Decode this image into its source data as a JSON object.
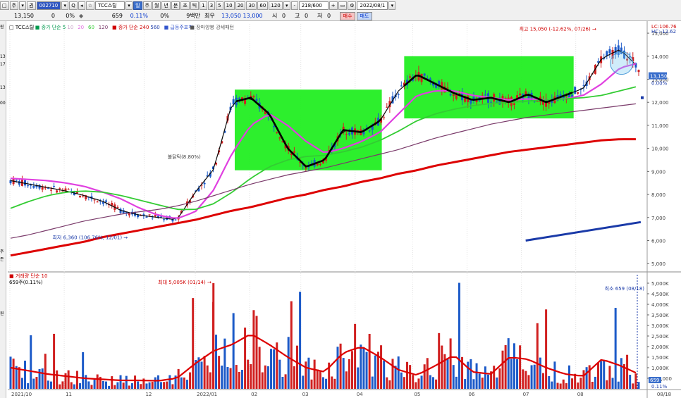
{
  "toolbar": {
    "row1": [
      {
        "name": "layout-icon",
        "label": "□",
        "kind": "btn"
      },
      {
        "name": "menu-main-button",
        "label": "주",
        "kind": "btn"
      },
      {
        "name": "dropdown-icon",
        "label": "▾",
        "kind": "btn"
      },
      {
        "name": "market-select",
        "label": "권",
        "kind": "btn"
      },
      {
        "name": "stock-code-field",
        "label": "002710",
        "kind": "code"
      },
      {
        "name": "code-dropdown-icon",
        "label": "▾",
        "kind": "btn"
      },
      {
        "name": "search-icon",
        "label": "Q",
        "kind": "btn"
      },
      {
        "name": "prev-icon",
        "label": "◂",
        "kind": "btn"
      },
      {
        "name": "favorite-icon",
        "label": "☆",
        "kind": "btn"
      },
      {
        "name": "stock-name-field",
        "label": "TCC스틸",
        "kind": "name"
      },
      {
        "name": "name-dropdown-icon",
        "label": "▾",
        "kind": "btn"
      },
      {
        "name": "period-day-button",
        "label": "일",
        "kind": "sel"
      },
      {
        "name": "period-week-button",
        "label": "주",
        "kind": "btn"
      },
      {
        "name": "period-month-button",
        "label": "월",
        "kind": "btn"
      },
      {
        "name": "period-year-button",
        "label": "년",
        "kind": "btn"
      },
      {
        "name": "period-minute-button",
        "label": "분",
        "kind": "btn"
      },
      {
        "name": "period-second-button",
        "label": "초",
        "kind": "btn"
      },
      {
        "name": "period-tick-button",
        "label": "틱",
        "kind": "btn"
      },
      {
        "name": "interval-1-button",
        "label": "1",
        "kind": "btn"
      },
      {
        "name": "interval-3-button",
        "label": "3",
        "kind": "btn"
      },
      {
        "name": "interval-5-button",
        "label": "5",
        "kind": "btn"
      },
      {
        "name": "interval-10-button",
        "label": "10",
        "kind": "btn"
      },
      {
        "name": "interval-20-button",
        "label": "20",
        "kind": "btn"
      },
      {
        "name": "interval-30-button",
        "label": "30",
        "kind": "btn"
      },
      {
        "name": "interval-60-button",
        "label": "60",
        "kind": "btn"
      },
      {
        "name": "interval-120-button",
        "label": "120",
        "kind": "btn"
      },
      {
        "name": "interval-dropdown-icon",
        "label": "▾",
        "kind": "btn"
      },
      {
        "name": "minus-button",
        "label": "-",
        "kind": "btn"
      },
      {
        "name": "count-field",
        "label": "218/600",
        "kind": "name"
      },
      {
        "name": "plus-button",
        "label": "+",
        "kind": "btn"
      },
      {
        "name": "range-button",
        "label": "▭",
        "kind": "btn"
      },
      {
        "name": "settings-icon",
        "label": "⚙",
        "kind": "btn"
      },
      {
        "name": "date-field",
        "label": "2022/08/1",
        "kind": "name"
      },
      {
        "name": "calendar-icon",
        "label": "▾",
        "kind": "btn"
      }
    ],
    "quote": {
      "price": "13,150",
      "change": "0",
      "change_pct": "0%",
      "dot_icon": "◆",
      "volume": "659",
      "volume_pct": "0.11%",
      "zero_pct": "0%",
      "turnover": "9백만",
      "tag_recent": "최우",
      "hi_lo": "13,050 13,000",
      "open_label": "시",
      "open": "0",
      "high_label": "고",
      "high": "0",
      "low_label": "저",
      "low": "0",
      "buy_label": "매수",
      "sell_label": "매도"
    }
  },
  "left_tags": [
    "원",
    "",
    "",
    "",
    "13",
    "17",
    "",
    "",
    "13",
    "",
    "00",
    "",
    "",
    "",
    "",
    "",
    "",
    "",
    "",
    "",
    "",
    "",
    "",
    "",
    "",
    "",
    "",
    "",
    "",
    "주",
    "존",
    "",
    "",
    "",
    "",
    "",
    "",
    "원",
    "",
    "",
    "",
    "",
    "",
    "",
    "",
    "",
    "",
    ""
  ],
  "price_panel": {
    "legend": [
      {
        "text": "□ TCC스틸",
        "color": "#000000"
      },
      {
        "text": "■ 종가 단순 5",
        "color": "#00994d"
      },
      {
        "text": "10",
        "color": "#c8a2c8"
      },
      {
        "text": "20",
        "color": "#e070e0"
      },
      {
        "text": "60",
        "color": "#33cc33"
      },
      {
        "text": "120",
        "color": "#7a3a6a"
      },
      {
        "text": "■ 종가 단순 240",
        "color": "#d00000"
      },
      {
        "text": "560",
        "color": "#1a3aa8"
      },
      {
        "text": "■ 급등주포착",
        "color": "#3355cc"
      },
      {
        "text": "■ 장마양봉 강세패턴",
        "color": "#555555"
      }
    ],
    "annotations": {
      "high": "최고 15,050 (-12.62%, 07/26)",
      "low": "최저 6,360 (106.76%, 12/01)",
      "spike": "불닭탁(8.80%)",
      "lc": "LC:106.76",
      "hc": "HC:-12.62",
      "current_tag": "13,150",
      "current_pct": "0.00%"
    },
    "y_labels": [
      "15,000",
      "14,000",
      "13,000",
      "12,000",
      "11,000",
      "10,000",
      "9,000",
      "8,000",
      "7,000",
      "6,000",
      "5,000"
    ]
  },
  "volume_panel": {
    "legend": [
      {
        "text": "■ 거래량 단순 10",
        "color": "#d00000"
      }
    ],
    "sub_label": "659주(0.11%)",
    "annotations": {
      "max": "최대 5,005K (01/14)",
      "min": "최소 659 (08/18)",
      "current_tag": "659",
      "current_pct": "0.11%"
    },
    "y_labels": [
      "5,000K",
      "4,500K",
      "4,000K",
      "3,500K",
      "3,000K",
      "2,500K",
      "2,000K",
      "1,500K",
      "1,000K",
      "500,000"
    ]
  },
  "x_labels": [
    "2021/10",
    "11",
    "12",
    "2022/01",
    "02",
    "03",
    "04",
    "05",
    "06",
    "07",
    "08",
    "08/18"
  ],
  "chart_data": [
    {
      "type": "candlestick",
      "title": "TCC스틸",
      "ylim": [
        4700,
        15400
      ],
      "y_ticks": [
        5000,
        6000,
        7000,
        8000,
        9000,
        10000,
        11000,
        12000,
        13000,
        14000,
        15000
      ],
      "x_ticks": [
        "2021/10",
        "11",
        "12",
        "2022/01",
        "02",
        "03",
        "04",
        "05",
        "06",
        "07",
        "08"
      ],
      "series": [
        {
          "name": "종가 단순 5",
          "values": [
            8600,
            8450,
            8300,
            8150,
            7950,
            7700,
            7300,
            7100,
            7000,
            6900,
            8100,
            9100,
            12000,
            12200,
            11500,
            10000,
            9200,
            9500,
            10800,
            10700,
            11200,
            12500,
            13200,
            12800,
            12400,
            12100,
            12200,
            12000,
            12350,
            12000,
            12300,
            12600,
            13900,
            14300,
            13500
          ]
        },
        {
          "name": "종가 단순 20",
          "values": [
            8700,
            8650,
            8600,
            8500,
            8350,
            8100,
            7800,
            7400,
            7100,
            6950,
            7250,
            8200,
            9800,
            11000,
            11500,
            11000,
            10300,
            9800,
            10000,
            10300,
            10700,
            11500,
            12300,
            12500,
            12500,
            12300,
            12200,
            12100,
            12150,
            12100,
            12150,
            12300,
            12800,
            13500,
            13700
          ]
        },
        {
          "name": "종가 단순 60",
          "values": [
            7400,
            7700,
            7950,
            8100,
            8150,
            8100,
            7950,
            7750,
            7550,
            7350,
            7350,
            7600,
            8100,
            8700,
            9200,
            9500,
            9650,
            9700,
            9850,
            10050,
            10350,
            10750,
            11200,
            11500,
            11700,
            11850,
            11950,
            12000,
            12050,
            12100,
            12150,
            12200,
            12300,
            12500,
            12700
          ]
        },
        {
          "name": "종가 단순 120",
          "values": [
            6100,
            6250,
            6450,
            6650,
            6850,
            7000,
            7150,
            7250,
            7350,
            7500,
            7700,
            7950,
            8200,
            8450,
            8650,
            8850,
            9000,
            9150,
            9350,
            9550,
            9750,
            9950,
            10200,
            10450,
            10650,
            10850,
            11050,
            11200,
            11350,
            11450,
            11550,
            11650,
            11750,
            11850,
            11950
          ]
        },
        {
          "name": "종가 단순 240",
          "values": [
            5350,
            5500,
            5650,
            5800,
            5950,
            6150,
            6300,
            6450,
            6600,
            6750,
            6900,
            7100,
            7300,
            7450,
            7650,
            7850,
            8000,
            8200,
            8350,
            8550,
            8700,
            8900,
            9050,
            9250,
            9400,
            9550,
            9700,
            9850,
            9950,
            10050,
            10150,
            10250,
            10350,
            10400,
            10400
          ]
        },
        {
          "name": "종가 단순 560",
          "x_range": [
            0.81,
            0.99
          ],
          "values": [
            6000,
            6800
          ]
        }
      ],
      "high": {
        "value": 15050,
        "date": "07/26"
      },
      "low": {
        "value": 6360,
        "date": "12/01"
      },
      "last": 13150
    },
    {
      "type": "bar",
      "title": "거래량",
      "ylim": [
        0,
        5400
      ],
      "y_unit": "K",
      "y_ticks": [
        500,
        1000,
        1500,
        2000,
        2500,
        3000,
        3500,
        4000,
        4500,
        5000
      ],
      "series": [
        {
          "name": "거래량 단순 10",
          "values": [
            1000,
            850,
            700,
            600,
            500,
            450,
            400,
            400,
            380,
            500,
            1200,
            1800,
            2100,
            2600,
            2100,
            1500,
            1000,
            800,
            1700,
            2000,
            1500,
            900,
            650,
            1100,
            1600,
            800,
            700,
            1500,
            1400,
            1000,
            700,
            600,
            1400,
            1100,
            700
          ]
        }
      ],
      "max": {
        "value": 5005,
        "date": "01/14"
      },
      "min": {
        "value": 0.659,
        "date": "08/18"
      }
    }
  ]
}
